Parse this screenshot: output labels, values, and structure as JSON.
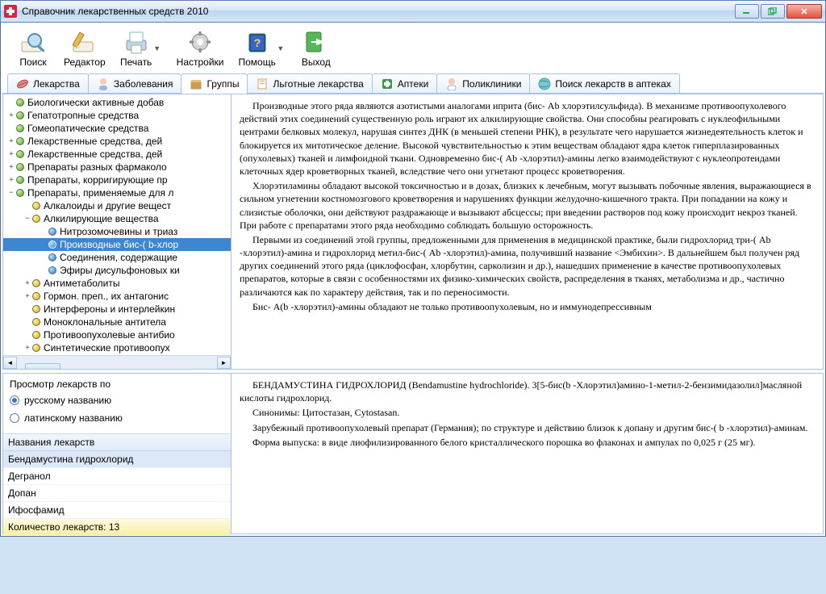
{
  "app": {
    "title": "Справочник лекарственных средств 2010"
  },
  "toolbar": {
    "search": "Поиск",
    "editor": "Редактор",
    "print": "Печать",
    "settings": "Настройки",
    "help": "Помощь",
    "exit": "Выход"
  },
  "tabs": {
    "drugs": "Лекарства",
    "diseases": "Заболевания",
    "groups": "Группы",
    "benefit": "Льготные лекарства",
    "pharm": "Аптеки",
    "clinics": "Поликлиники",
    "searchpharm": "Поиск лекарств в аптеках"
  },
  "tree": {
    "items": [
      {
        "lvl": "l1",
        "exp": "",
        "dot": "g",
        "txt": "Биологически активные добав"
      },
      {
        "lvl": "l1",
        "exp": "+",
        "dot": "g",
        "txt": "Гепатотропные средства"
      },
      {
        "lvl": "l1",
        "exp": "",
        "dot": "g",
        "txt": "Гомеопатические средства"
      },
      {
        "lvl": "l1",
        "exp": "+",
        "dot": "g",
        "txt": "Лекарственные средства, дей"
      },
      {
        "lvl": "l1",
        "exp": "+",
        "dot": "g",
        "txt": "Лекарственные средства, дей"
      },
      {
        "lvl": "l1",
        "exp": "+",
        "dot": "g",
        "txt": "Препараты разных фармаколо"
      },
      {
        "lvl": "l1",
        "exp": "+",
        "dot": "g",
        "txt": "Препараты, корригирующие пр"
      },
      {
        "lvl": "l1",
        "exp": "−",
        "dot": "g",
        "txt": "Препараты, применяемые для л"
      },
      {
        "lvl": "l2",
        "exp": "",
        "dot": "y",
        "txt": "Алкалоиды и другие вещест"
      },
      {
        "lvl": "l2",
        "exp": "−",
        "dot": "y",
        "txt": "Алкилирующие вещества"
      },
      {
        "lvl": "l3",
        "exp": "",
        "dot": "b",
        "txt": "Нитрозомочевины и триаз"
      },
      {
        "lvl": "l3",
        "exp": "",
        "dot": "b",
        "txt": "Производные бис-( b-хлор",
        "sel": true
      },
      {
        "lvl": "l3",
        "exp": "",
        "dot": "b",
        "txt": "Соединения, содержащие"
      },
      {
        "lvl": "l3",
        "exp": "",
        "dot": "b",
        "txt": "Эфиры дисульфоновых ки"
      },
      {
        "lvl": "l2",
        "exp": "+",
        "dot": "y",
        "txt": "Антиметаболиты"
      },
      {
        "lvl": "l2",
        "exp": "+",
        "dot": "y",
        "txt": "Гормон. преп., их антагонис"
      },
      {
        "lvl": "l2",
        "exp": "",
        "dot": "y",
        "txt": "Интерфероны и интерлейкин"
      },
      {
        "lvl": "l2",
        "exp": "",
        "dot": "y",
        "txt": "Моноклональные антитела"
      },
      {
        "lvl": "l2",
        "exp": "",
        "dot": "y",
        "txt": "Противоопухолевые антибио"
      },
      {
        "lvl": "l2",
        "exp": "+",
        "dot": "y",
        "txt": "Синтетические противоопух"
      }
    ]
  },
  "desc": {
    "p1": "Производные этого ряда являются азотистыми аналогами иприта (бис- Ab хлорэтилсульфида). В механизме противоопухолевого действий этих соединений существенную роль играют их алкилирующие свойства. Они способны реагировать с нуклеофильными центрами белковых молекул, нарушая синтез ДНК (в меньшей степени РНК), в результате чего нарушается жизнедеятельность клеток и блокируется их митотическое деление. Высокой чувствительностью к этим веществам обладают ядра клеток гиперплазированных (опухолевых) тканей и лимфоидной ткани. Одновременно бис-( Ab -хлорэтил)-амины легко взаимодействуют с нуклеопротеидами клеточных ядер кроветворных тканей, вследствие чего они угнетают процесс кроветворения.",
    "p2": "Хлорэтиламины обладают высокой токсичностью и в дозах, близких к лечебным, могут вызывать побочные явления, выражающиеся в сильном угнетении костномозгового кроветворения и нарушениях функции желудочно-кишечного тракта. При попадании на кожу и слизистые оболочки, они действуют раздражающе и вызывают абсцессы; при введении растворов под кожу происходит некроз тканей. При работе с препаратами этого ряда необходимо соблюдать большую осторожность.",
    "p3": "Первыми из соединений этой группы, предложенными для применения в медицинской практике, были гидрохлорид три-( Ab -хлорэтил)-амина и гидрохлорид метил-бис-( Ab -хлорэтил)-амина, получивший название <Эмбихин>. В дальнейшем был получен ряд других соединений этого ряда (циклофосфан, хлорбутин, сарколизин и др.), нашедших применение в качестве противоопухолевых препаратов, которые в связи с особенностями их физико-химических свойств, распределения в тканях, метаболизма и др., частично различаются как по характеру действия, так и по переносимости.",
    "p4": "Бис- A(b -хлорэтил)-амины обладают не только противоопухолевым, но и иммунодепрессивным"
  },
  "viewby": {
    "label": "Просмотр лекарств по",
    "opt1": "русскому названию",
    "opt2": "латинскому названию"
  },
  "druglist": {
    "header": "Названия лекарств",
    "rows": [
      "Бендамустина гидрохлорид",
      "Дегранол",
      "Допан",
      "Ифосфамид"
    ],
    "footer": "Количество лекарств: 13"
  },
  "drugdesc": {
    "p1": "БЕНДАМУСТИНА ГИДРОХЛОРИД (Bendamustine hydrochloride). 3[5-бис(b -Хлорэтил)амино-1-метил-2-бензимидазолил]масляной кислоты гидрохлорид.",
    "p2": "Синонимы: Цитостазан, Cytostasan.",
    "p3": "Зарубежный противоопухолевый препарат (Германия); по структуре и действию близок к допану и другим бис-( b -хлорэтил)-аминам.",
    "p4": "Форма выпуска: в виде лиофилизированного белого кристаллического порошка во флаконах и ампулах по 0,025 г (25 мг)."
  }
}
